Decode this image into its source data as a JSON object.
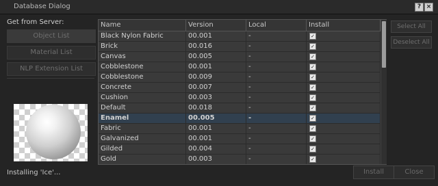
{
  "window": {
    "title": "Database Dialog"
  },
  "left": {
    "label": "Get from Server:",
    "buttons": [
      "Object List",
      "Material List",
      "NLP Extension List"
    ]
  },
  "table": {
    "columns": [
      "Name",
      "Version",
      "Local",
      "Install"
    ],
    "rows": [
      {
        "name": "Black Nylon Fabric",
        "version": "00.001",
        "local": "-",
        "install": "✓"
      },
      {
        "name": "Brick",
        "version": "00.016",
        "local": "-",
        "install": "✓"
      },
      {
        "name": "Canvas",
        "version": "00.005",
        "local": "-",
        "install": "✓"
      },
      {
        "name": "Cobblestone",
        "version": "00.001",
        "local": "-",
        "install": "✓"
      },
      {
        "name": "Cobblestone",
        "version": "00.009",
        "local": "-",
        "install": "✓"
      },
      {
        "name": "Concrete",
        "version": "00.007",
        "local": "-",
        "install": "✓"
      },
      {
        "name": "Cushion",
        "version": "00.003",
        "local": "-",
        "install": "✓"
      },
      {
        "name": "Default",
        "version": "00.018",
        "local": "-",
        "install": "✓"
      },
      {
        "name": "Enamel",
        "version": "00.005",
        "local": "-",
        "install": "✓"
      },
      {
        "name": "Fabric",
        "version": "00.001",
        "local": "-",
        "install": "✓"
      },
      {
        "name": "Galvanized",
        "version": "00.001",
        "local": "-",
        "install": "✓"
      },
      {
        "name": "Gilded",
        "version": "00.004",
        "local": "-",
        "install": "✓"
      },
      {
        "name": "Gold",
        "version": "00.003",
        "local": "-",
        "install": "✓"
      }
    ]
  },
  "right": {
    "buttons": [
      "Select All",
      "Deselect All"
    ]
  },
  "footer": {
    "status": "Installing 'Ice'...",
    "install": "Install",
    "close": "Close"
  }
}
